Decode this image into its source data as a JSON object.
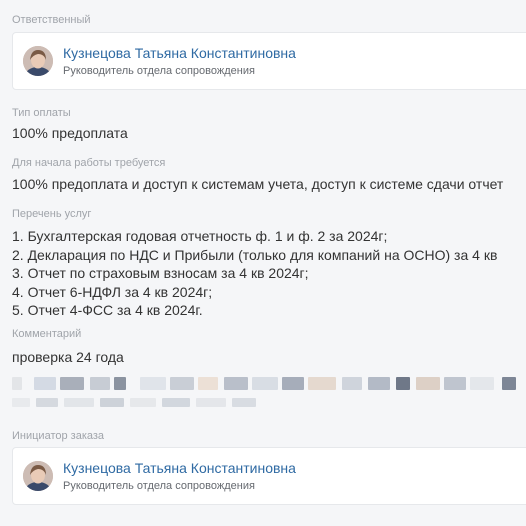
{
  "responsible": {
    "label": "Ответственный",
    "name": "Кузнецова Татьяна Константиновна",
    "role": "Руководитель отдела сопровождения"
  },
  "payment_type": {
    "label": "Тип оплаты",
    "value": "100% предоплата"
  },
  "requirements": {
    "label": "Для начала работы требуется",
    "value": "100% предоплата и доступ к системам учета, доступ к системе сдачи отчет"
  },
  "services": {
    "label": "Перечень услуг",
    "items": [
      "1. Бухгалтерская годовая отчетность ф. 1 и ф. 2 за 2024г;",
      "2. Декларация по НДС и Прибыли (только для компаний на ОСНО) за 4 кв",
      "3. Отчет по страховым взносам за 4 кв 2024г;",
      "4. Отчет 6-НДФЛ за 4 кв 2024г;",
      "5. Отчет 4-ФСС за 4 кв 2024г."
    ]
  },
  "comment": {
    "label": "Комментарий",
    "value": "проверка 24 года"
  },
  "initiator": {
    "label": "Инициатор заказа",
    "name": "Кузнецова Татьяна Константиновна",
    "role": "Руководитель отдела сопровождения"
  },
  "colors": {
    "page_bg": "#f5f6f8",
    "card_bg": "#ffffff",
    "link_name": "#2f6aa3",
    "label": "#a0a4aa",
    "text": "#333333"
  }
}
